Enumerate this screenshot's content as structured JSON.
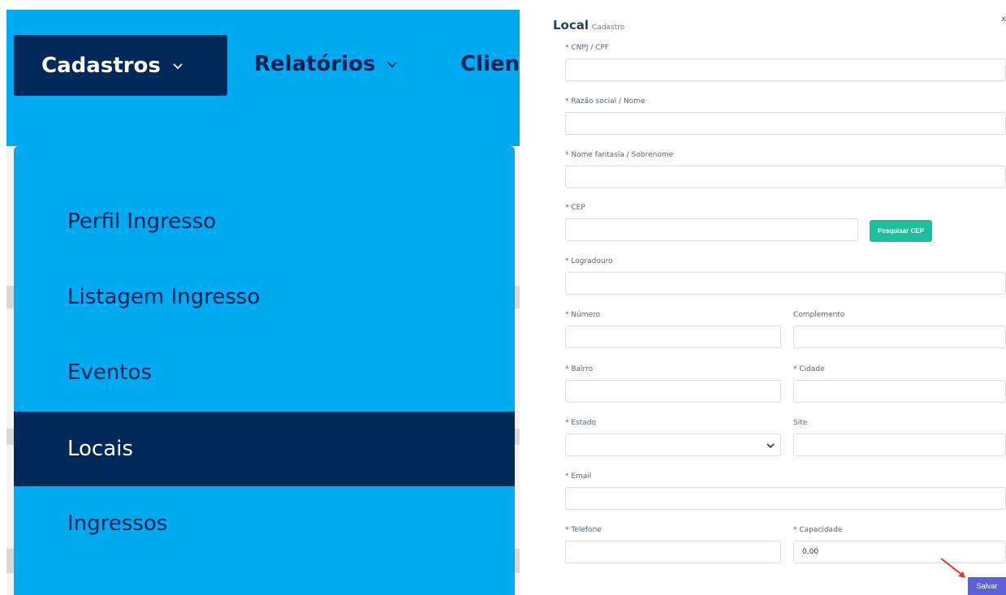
{
  "nav": {
    "items": [
      {
        "label": "Cadastros"
      },
      {
        "label": "Relatórios"
      },
      {
        "label": "Clien"
      }
    ]
  },
  "dropdown": {
    "items": [
      {
        "label": "Perfil Ingresso"
      },
      {
        "label": "Listagem Ingresso"
      },
      {
        "label": "Eventos"
      },
      {
        "label": "Locais",
        "active": true
      },
      {
        "label": "Ingressos"
      }
    ]
  },
  "form": {
    "title": "Local",
    "subtitle": "Cadastro",
    "close": "x",
    "fields": {
      "cnpj": {
        "label": "* CNPJ / CPF",
        "value": ""
      },
      "razao": {
        "label": "* Razão social / Nome",
        "value": ""
      },
      "fantasia": {
        "label": "* Nome fantasia / Sobrenome",
        "value": ""
      },
      "cep": {
        "label": "* CEP",
        "value": ""
      },
      "logradouro": {
        "label": "* Logradouro",
        "value": ""
      },
      "numero": {
        "label": "* Número",
        "value": ""
      },
      "complemento": {
        "label": "Complemento",
        "value": ""
      },
      "bairro": {
        "label": "* Bairro",
        "value": ""
      },
      "cidade": {
        "label": "* Cidade",
        "value": ""
      },
      "estado": {
        "label": "* Estado",
        "value": ""
      },
      "site": {
        "label": "Site",
        "value": ""
      },
      "email": {
        "label": "* Email",
        "value": ""
      },
      "telefone": {
        "label": "* Telefone",
        "value": ""
      },
      "capacidade": {
        "label": "* Capacidade",
        "value": "0,00"
      }
    },
    "buttons": {
      "pesquisar_cep": "Pesquisar CEP",
      "salvar": "Salvar"
    }
  },
  "colors": {
    "nav_bg": "#00aaf0",
    "nav_active": "#00295a",
    "cep_button": "#1cbf9c",
    "save_button": "#5c62d6",
    "arrow": "#e53030"
  }
}
